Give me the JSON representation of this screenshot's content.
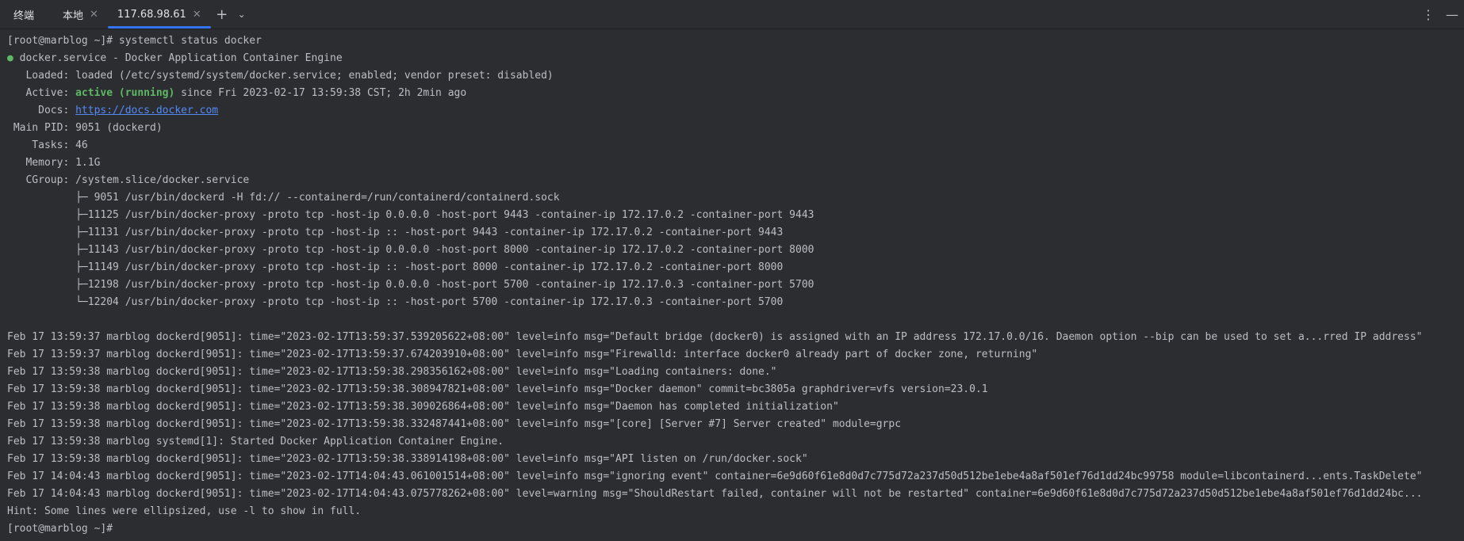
{
  "tabbar": {
    "title": "终端",
    "tabs": [
      {
        "label": "本地",
        "active": false
      },
      {
        "label": "117.68.98.61",
        "active": true
      }
    ],
    "new_tab_icon": "+",
    "dropdown_icon": "⌄",
    "more_icon": "⋮",
    "minimize_icon": "—"
  },
  "colors": {
    "accent": "#3574f0",
    "ok": "#5fb865",
    "link": "#548af7",
    "bg": "#2b2d30",
    "text": "#bcbec4"
  },
  "terminal": {
    "prompt_cmd": "[root@marblog ~]# systemctl status docker",
    "status_dot": "●",
    "service_line": " docker.service - Docker Application Container Engine",
    "loaded": "   Loaded: loaded (/etc/systemd/system/docker.service; enabled; vendor preset: disabled)",
    "active_prefix": "   Active: ",
    "active_state": "active (running)",
    "active_suffix": " since Fri 2023-02-17 13:59:38 CST; 2h 2min ago",
    "docs_prefix": "     Docs: ",
    "docs_link": "https://docs.docker.com",
    "main_pid": " Main PID: 9051 (dockerd)",
    "tasks": "    Tasks: 46",
    "memory": "   Memory: 1.1G",
    "cgroup": "   CGroup: /system.slice/docker.service",
    "cgroup_tree": [
      "           ├─ 9051 /usr/bin/dockerd -H fd:// --containerd=/run/containerd/containerd.sock",
      "           ├─11125 /usr/bin/docker-proxy -proto tcp -host-ip 0.0.0.0 -host-port 9443 -container-ip 172.17.0.2 -container-port 9443",
      "           ├─11131 /usr/bin/docker-proxy -proto tcp -host-ip :: -host-port 9443 -container-ip 172.17.0.2 -container-port 9443",
      "           ├─11143 /usr/bin/docker-proxy -proto tcp -host-ip 0.0.0.0 -host-port 8000 -container-ip 172.17.0.2 -container-port 8000",
      "           ├─11149 /usr/bin/docker-proxy -proto tcp -host-ip :: -host-port 8000 -container-ip 172.17.0.2 -container-port 8000",
      "           ├─12198 /usr/bin/docker-proxy -proto tcp -host-ip 0.0.0.0 -host-port 5700 -container-ip 172.17.0.3 -container-port 5700",
      "           └─12204 /usr/bin/docker-proxy -proto tcp -host-ip :: -host-port 5700 -container-ip 172.17.0.3 -container-port 5700"
    ],
    "logs": [
      "Feb 17 13:59:37 marblog dockerd[9051]: time=\"2023-02-17T13:59:37.539205622+08:00\" level=info msg=\"Default bridge (docker0) is assigned with an IP address 172.17.0.0/16. Daemon option --bip can be used to set a...rred IP address\"",
      "Feb 17 13:59:37 marblog dockerd[9051]: time=\"2023-02-17T13:59:37.674203910+08:00\" level=info msg=\"Firewalld: interface docker0 already part of docker zone, returning\"",
      "Feb 17 13:59:38 marblog dockerd[9051]: time=\"2023-02-17T13:59:38.298356162+08:00\" level=info msg=\"Loading containers: done.\"",
      "Feb 17 13:59:38 marblog dockerd[9051]: time=\"2023-02-17T13:59:38.308947821+08:00\" level=info msg=\"Docker daemon\" commit=bc3805a graphdriver=vfs version=23.0.1",
      "Feb 17 13:59:38 marblog dockerd[9051]: time=\"2023-02-17T13:59:38.309026864+08:00\" level=info msg=\"Daemon has completed initialization\"",
      "Feb 17 13:59:38 marblog dockerd[9051]: time=\"2023-02-17T13:59:38.332487441+08:00\" level=info msg=\"[core] [Server #7] Server created\" module=grpc",
      "Feb 17 13:59:38 marblog systemd[1]: Started Docker Application Container Engine.",
      "Feb 17 13:59:38 marblog dockerd[9051]: time=\"2023-02-17T13:59:38.338914198+08:00\" level=info msg=\"API listen on /run/docker.sock\"",
      "Feb 17 14:04:43 marblog dockerd[9051]: time=\"2023-02-17T14:04:43.061001514+08:00\" level=info msg=\"ignoring event\" container=6e9d60f61e8d0d7c775d72a237d50d512be1ebe4a8af501ef76d1dd24bc99758 module=libcontainerd...ents.TaskDelete\"",
      "Feb 17 14:04:43 marblog dockerd[9051]: time=\"2023-02-17T14:04:43.075778262+08:00\" level=warning msg=\"ShouldRestart failed, container will not be restarted\" container=6e9d60f61e8d0d7c775d72a237d50d512be1ebe4a8af501ef76d1dd24bc..."
    ],
    "hint": "Hint: Some lines were ellipsized, use -l to show in full.",
    "final_prompt": "[root@marblog ~]# "
  }
}
